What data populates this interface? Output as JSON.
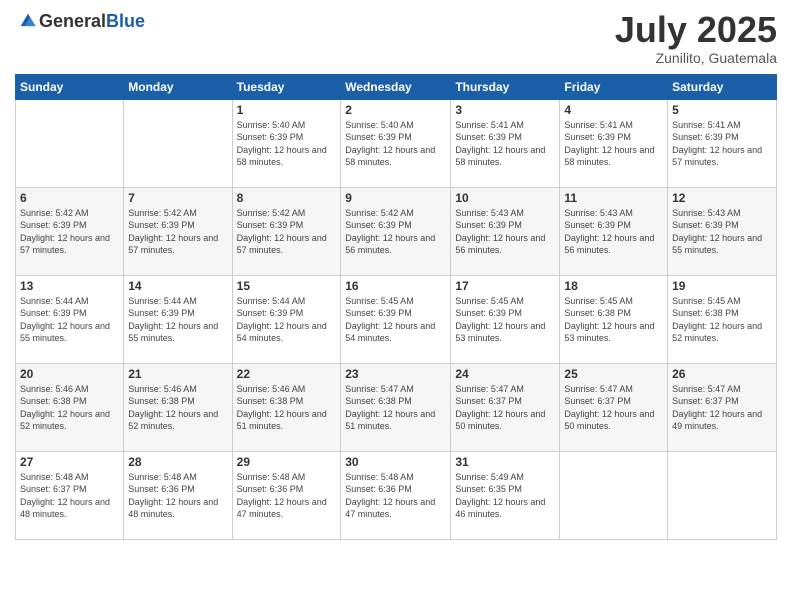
{
  "header": {
    "logo": {
      "general": "General",
      "blue": "Blue"
    },
    "title": "July 2025",
    "location": "Zunilito, Guatemala"
  },
  "weekdays": [
    "Sunday",
    "Monday",
    "Tuesday",
    "Wednesday",
    "Thursday",
    "Friday",
    "Saturday"
  ],
  "weeks": [
    [
      {
        "day": "",
        "sunrise": "",
        "sunset": "",
        "daylight": ""
      },
      {
        "day": "",
        "sunrise": "",
        "sunset": "",
        "daylight": ""
      },
      {
        "day": "1",
        "sunrise": "Sunrise: 5:40 AM",
        "sunset": "Sunset: 6:39 PM",
        "daylight": "Daylight: 12 hours and 58 minutes."
      },
      {
        "day": "2",
        "sunrise": "Sunrise: 5:40 AM",
        "sunset": "Sunset: 6:39 PM",
        "daylight": "Daylight: 12 hours and 58 minutes."
      },
      {
        "day": "3",
        "sunrise": "Sunrise: 5:41 AM",
        "sunset": "Sunset: 6:39 PM",
        "daylight": "Daylight: 12 hours and 58 minutes."
      },
      {
        "day": "4",
        "sunrise": "Sunrise: 5:41 AM",
        "sunset": "Sunset: 6:39 PM",
        "daylight": "Daylight: 12 hours and 58 minutes."
      },
      {
        "day": "5",
        "sunrise": "Sunrise: 5:41 AM",
        "sunset": "Sunset: 6:39 PM",
        "daylight": "Daylight: 12 hours and 57 minutes."
      }
    ],
    [
      {
        "day": "6",
        "sunrise": "Sunrise: 5:42 AM",
        "sunset": "Sunset: 6:39 PM",
        "daylight": "Daylight: 12 hours and 57 minutes."
      },
      {
        "day": "7",
        "sunrise": "Sunrise: 5:42 AM",
        "sunset": "Sunset: 6:39 PM",
        "daylight": "Daylight: 12 hours and 57 minutes."
      },
      {
        "day": "8",
        "sunrise": "Sunrise: 5:42 AM",
        "sunset": "Sunset: 6:39 PM",
        "daylight": "Daylight: 12 hours and 57 minutes."
      },
      {
        "day": "9",
        "sunrise": "Sunrise: 5:42 AM",
        "sunset": "Sunset: 6:39 PM",
        "daylight": "Daylight: 12 hours and 56 minutes."
      },
      {
        "day": "10",
        "sunrise": "Sunrise: 5:43 AM",
        "sunset": "Sunset: 6:39 PM",
        "daylight": "Daylight: 12 hours and 56 minutes."
      },
      {
        "day": "11",
        "sunrise": "Sunrise: 5:43 AM",
        "sunset": "Sunset: 6:39 PM",
        "daylight": "Daylight: 12 hours and 56 minutes."
      },
      {
        "day": "12",
        "sunrise": "Sunrise: 5:43 AM",
        "sunset": "Sunset: 6:39 PM",
        "daylight": "Daylight: 12 hours and 55 minutes."
      }
    ],
    [
      {
        "day": "13",
        "sunrise": "Sunrise: 5:44 AM",
        "sunset": "Sunset: 6:39 PM",
        "daylight": "Daylight: 12 hours and 55 minutes."
      },
      {
        "day": "14",
        "sunrise": "Sunrise: 5:44 AM",
        "sunset": "Sunset: 6:39 PM",
        "daylight": "Daylight: 12 hours and 55 minutes."
      },
      {
        "day": "15",
        "sunrise": "Sunrise: 5:44 AM",
        "sunset": "Sunset: 6:39 PM",
        "daylight": "Daylight: 12 hours and 54 minutes."
      },
      {
        "day": "16",
        "sunrise": "Sunrise: 5:45 AM",
        "sunset": "Sunset: 6:39 PM",
        "daylight": "Daylight: 12 hours and 54 minutes."
      },
      {
        "day": "17",
        "sunrise": "Sunrise: 5:45 AM",
        "sunset": "Sunset: 6:39 PM",
        "daylight": "Daylight: 12 hours and 53 minutes."
      },
      {
        "day": "18",
        "sunrise": "Sunrise: 5:45 AM",
        "sunset": "Sunset: 6:38 PM",
        "daylight": "Daylight: 12 hours and 53 minutes."
      },
      {
        "day": "19",
        "sunrise": "Sunrise: 5:45 AM",
        "sunset": "Sunset: 6:38 PM",
        "daylight": "Daylight: 12 hours and 52 minutes."
      }
    ],
    [
      {
        "day": "20",
        "sunrise": "Sunrise: 5:46 AM",
        "sunset": "Sunset: 6:38 PM",
        "daylight": "Daylight: 12 hours and 52 minutes."
      },
      {
        "day": "21",
        "sunrise": "Sunrise: 5:46 AM",
        "sunset": "Sunset: 6:38 PM",
        "daylight": "Daylight: 12 hours and 52 minutes."
      },
      {
        "day": "22",
        "sunrise": "Sunrise: 5:46 AM",
        "sunset": "Sunset: 6:38 PM",
        "daylight": "Daylight: 12 hours and 51 minutes."
      },
      {
        "day": "23",
        "sunrise": "Sunrise: 5:47 AM",
        "sunset": "Sunset: 6:38 PM",
        "daylight": "Daylight: 12 hours and 51 minutes."
      },
      {
        "day": "24",
        "sunrise": "Sunrise: 5:47 AM",
        "sunset": "Sunset: 6:37 PM",
        "daylight": "Daylight: 12 hours and 50 minutes."
      },
      {
        "day": "25",
        "sunrise": "Sunrise: 5:47 AM",
        "sunset": "Sunset: 6:37 PM",
        "daylight": "Daylight: 12 hours and 50 minutes."
      },
      {
        "day": "26",
        "sunrise": "Sunrise: 5:47 AM",
        "sunset": "Sunset: 6:37 PM",
        "daylight": "Daylight: 12 hours and 49 minutes."
      }
    ],
    [
      {
        "day": "27",
        "sunrise": "Sunrise: 5:48 AM",
        "sunset": "Sunset: 6:37 PM",
        "daylight": "Daylight: 12 hours and 48 minutes."
      },
      {
        "day": "28",
        "sunrise": "Sunrise: 5:48 AM",
        "sunset": "Sunset: 6:36 PM",
        "daylight": "Daylight: 12 hours and 48 minutes."
      },
      {
        "day": "29",
        "sunrise": "Sunrise: 5:48 AM",
        "sunset": "Sunset: 6:36 PM",
        "daylight": "Daylight: 12 hours and 47 minutes."
      },
      {
        "day": "30",
        "sunrise": "Sunrise: 5:48 AM",
        "sunset": "Sunset: 6:36 PM",
        "daylight": "Daylight: 12 hours and 47 minutes."
      },
      {
        "day": "31",
        "sunrise": "Sunrise: 5:49 AM",
        "sunset": "Sunset: 6:35 PM",
        "daylight": "Daylight: 12 hours and 46 minutes."
      },
      {
        "day": "",
        "sunrise": "",
        "sunset": "",
        "daylight": ""
      },
      {
        "day": "",
        "sunrise": "",
        "sunset": "",
        "daylight": ""
      }
    ]
  ]
}
